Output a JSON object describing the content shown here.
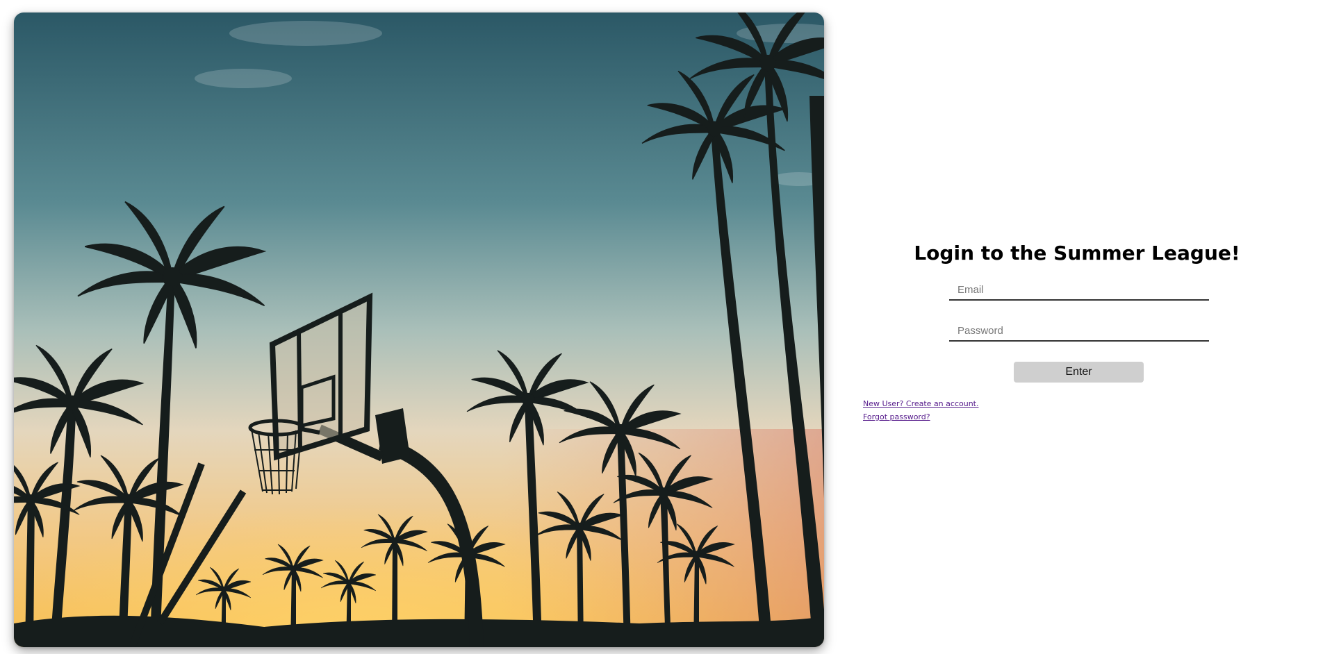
{
  "hero_image": {
    "icon": "basketball-hoop-sunset-photo",
    "colors": {
      "sky_top": "#2f5f6c",
      "sky_mid": "#8fb0b0",
      "sky_low": "#e7d2b1",
      "sky_bottom": "#f7c25a",
      "silhouette": "#161d1c"
    }
  },
  "login": {
    "title": "Login to the Summer League!",
    "email_placeholder": "Email",
    "email_value": "",
    "password_placeholder": "Password",
    "password_value": "",
    "enter_label": "Enter",
    "create_account_link": "New User? Create an account.",
    "forgot_password_link": "Forgot password?",
    "link_color": "#551a8b",
    "button_color": "#cfcfcf"
  }
}
